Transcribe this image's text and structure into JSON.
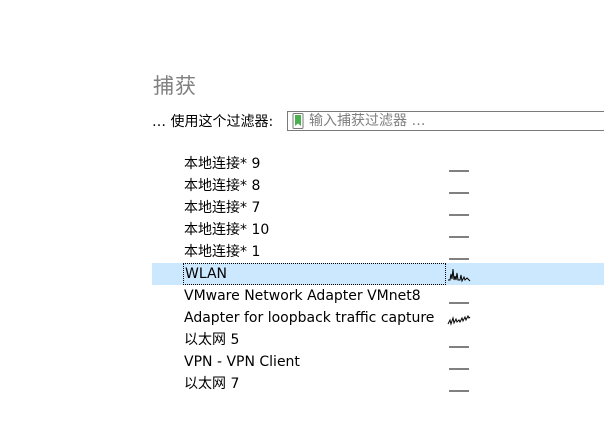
{
  "capture": {
    "title": "捕获",
    "filter_label": "… 使用这个过滤器:",
    "filter_placeholder": "输入捕获过滤器 …"
  },
  "interfaces": [
    {
      "name": "本地连接* 9",
      "activity": "idle",
      "selected": false
    },
    {
      "name": "本地连接* 8",
      "activity": "idle",
      "selected": false
    },
    {
      "name": "本地连接* 7",
      "activity": "idle",
      "selected": false
    },
    {
      "name": "本地连接* 10",
      "activity": "idle",
      "selected": false
    },
    {
      "name": "本地连接* 1",
      "activity": "idle",
      "selected": false
    },
    {
      "name": "WLAN",
      "activity": "active",
      "selected": true
    },
    {
      "name": "VMware Network Adapter VMnet8",
      "activity": "idle",
      "selected": false
    },
    {
      "name": "Adapter for loopback traffic capture",
      "activity": "active-low",
      "selected": false
    },
    {
      "name": "以太网 5",
      "activity": "idle",
      "selected": false
    },
    {
      "name": "VPN - VPN Client",
      "activity": "idle",
      "selected": false
    },
    {
      "name": "以太网 7",
      "activity": "idle",
      "selected": false
    }
  ],
  "colors": {
    "title": "#808080",
    "selected_row": "#cce8ff",
    "bookmark_icon": "#4caf50"
  },
  "icons": {
    "filter_bookmark": "bookmark-icon",
    "activity": "sparkline-icon"
  }
}
